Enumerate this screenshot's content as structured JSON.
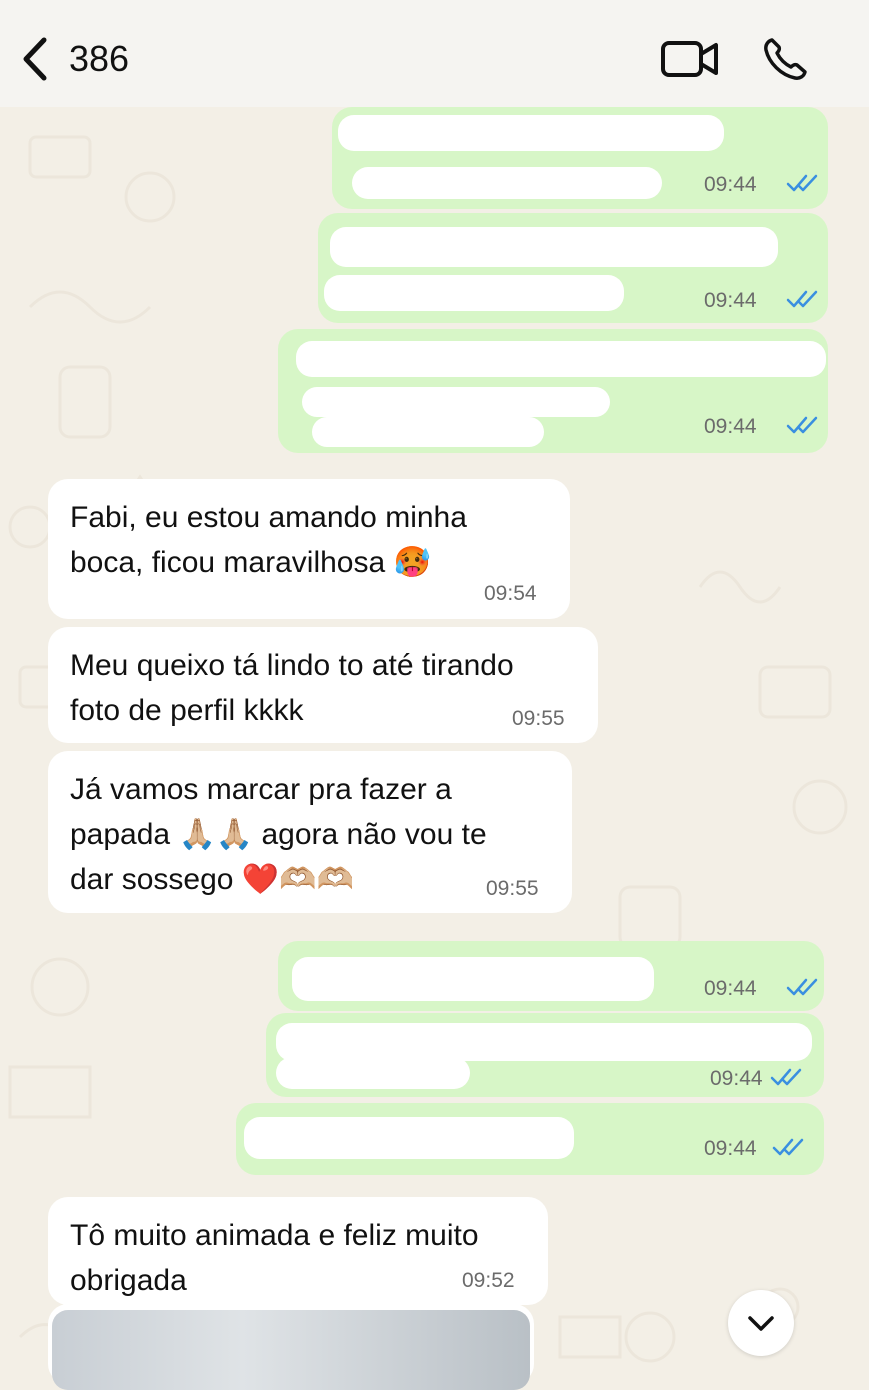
{
  "header": {
    "contact_name": "386"
  },
  "messages": [
    {
      "dir": "out",
      "time": "09:44"
    },
    {
      "dir": "out",
      "time": "09:44"
    },
    {
      "dir": "out",
      "time": "09:44"
    },
    {
      "dir": "in",
      "text": "Fabi, eu estou amando minha\nboca, ficou maravilhosa 🥵",
      "time": "09:54"
    },
    {
      "dir": "in",
      "text": "Meu queixo tá lindo to até tirando\nfoto de perfil kkkk",
      "time": "09:55"
    },
    {
      "dir": "in",
      "text": "Já vamos marcar pra fazer a\npapada 🙏🏼🙏🏼 agora não vou te\ndar sossego ❤️🫶🏼🫶🏼",
      "time": "09:55"
    },
    {
      "dir": "out",
      "time": "09:44"
    },
    {
      "dir": "out",
      "time": "09:44"
    },
    {
      "dir": "out",
      "time": "09:44"
    },
    {
      "dir": "in",
      "text": "Tô muito animada e feliz muito\nobrigada",
      "time": "09:52"
    }
  ],
  "colors": {
    "outgoing_bubble": "#d7f6c7",
    "incoming_bubble": "#ffffff",
    "read_ticks": "#3a8fe0",
    "chat_background": "#f3efe6"
  },
  "icons": {
    "back": "chevron-left-icon",
    "video": "video-camera-icon",
    "call": "phone-icon",
    "scroll": "chevron-down-icon",
    "read": "double-check-icon"
  }
}
